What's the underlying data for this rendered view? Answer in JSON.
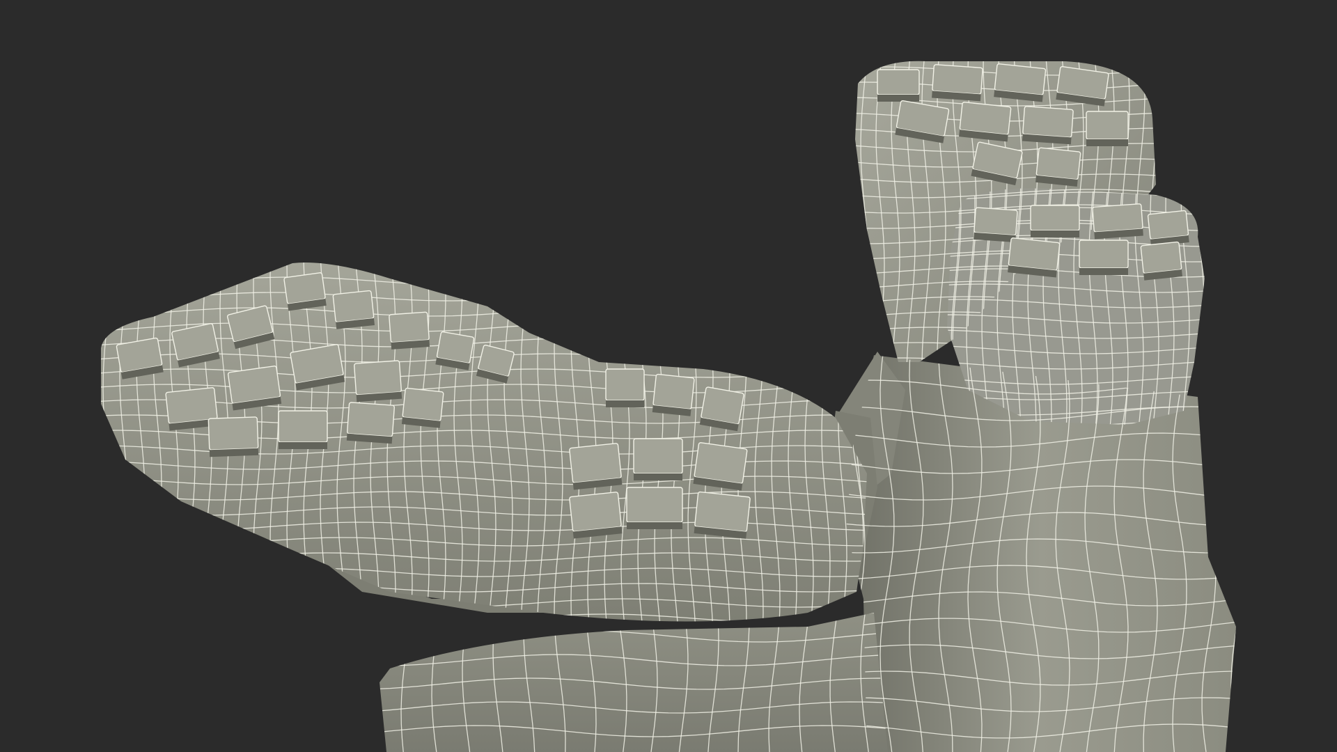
{
  "scene": {
    "subject": "boot-pair-wireframe",
    "colors": {
      "background": "#2b2b2b",
      "surface": "#8a8b7e",
      "surface_light": "#a3a498",
      "surface_shadow": "#62635a",
      "wire": "#f1f1e6"
    }
  }
}
